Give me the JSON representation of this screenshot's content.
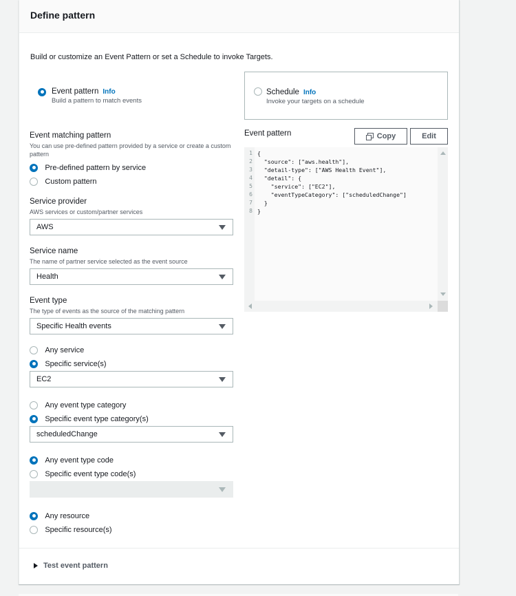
{
  "panel": {
    "title": "Define pattern",
    "description": "Build or customize an Event Pattern or set a Schedule to invoke Targets."
  },
  "mode_tiles": [
    {
      "label": "Event pattern",
      "info": "Info",
      "sub": "Build a pattern to match events",
      "selected": true
    },
    {
      "label": "Schedule",
      "info": "Info",
      "sub": "Invoke your targets on a schedule",
      "selected": false
    }
  ],
  "event_matching": {
    "label": "Event matching pattern",
    "sub": "You can use pre-defined pattern provided by a service or create a custom pattern",
    "options": [
      {
        "label": "Pre-defined pattern by service",
        "selected": true
      },
      {
        "label": "Custom pattern",
        "selected": false
      }
    ]
  },
  "service_provider": {
    "label": "Service provider",
    "sub": "AWS services or custom/partner services",
    "value": "AWS"
  },
  "service_name": {
    "label": "Service name",
    "sub": "The name of partner service selected as the event source",
    "value": "Health"
  },
  "event_type": {
    "label": "Event type",
    "sub": "The type of events as the source of the matching pattern",
    "value": "Specific Health events"
  },
  "service_scope": {
    "options": [
      {
        "label": "Any service",
        "selected": false
      },
      {
        "label": "Specific service(s)",
        "selected": true
      }
    ],
    "value": "EC2"
  },
  "category_scope": {
    "options": [
      {
        "label": "Any event type category",
        "selected": false
      },
      {
        "label": "Specific event type category(s)",
        "selected": true
      }
    ],
    "value": "scheduledChange"
  },
  "code_scope": {
    "options": [
      {
        "label": "Any event type code",
        "selected": true
      },
      {
        "label": "Specific event type code(s)",
        "selected": false
      }
    ],
    "value": ""
  },
  "resource_scope": {
    "options": [
      {
        "label": "Any resource",
        "selected": true
      },
      {
        "label": "Specific resource(s)",
        "selected": false
      }
    ]
  },
  "event_pattern": {
    "label": "Event pattern",
    "copy_label": "Copy",
    "edit_label": "Edit",
    "lines": [
      {
        "n": "1",
        "text": "{"
      },
      {
        "n": "2",
        "text": "  \"source\": [\"aws.health\"],"
      },
      {
        "n": "3",
        "text": "  \"detail-type\": [\"AWS Health Event\"],"
      },
      {
        "n": "4",
        "text": "  \"detail\": {"
      },
      {
        "n": "5",
        "text": "    \"service\": [\"EC2\"],"
      },
      {
        "n": "6",
        "text": "    \"eventTypeCategory\": [\"scheduledChange\"]"
      },
      {
        "n": "7",
        "text": "  }"
      },
      {
        "n": "8",
        "text": "}"
      }
    ]
  },
  "test_section": {
    "label": "Test event pattern"
  },
  "colors": {
    "accent": "#0073bb",
    "text": "#16191f",
    "muted": "#545b64"
  }
}
